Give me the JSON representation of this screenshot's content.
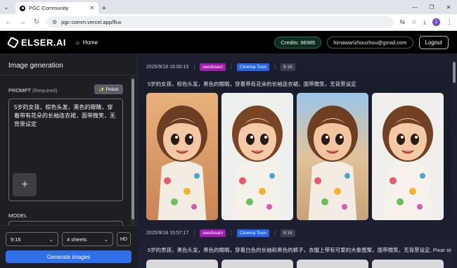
{
  "browser": {
    "tab_title": "PGC Community",
    "url": "pgc-comm.vercel.app/flux",
    "profile_initial": "Z"
  },
  "header": {
    "logo": "ELSER.AI",
    "home": "Home",
    "credits": "Credits: 96985",
    "email": "himawarizhouzhou@gmail.com",
    "logout": "Logout"
  },
  "left": {
    "title": "Image generation",
    "prompt_label": "PROMPT",
    "prompt_required": "(Required)",
    "polish": "Polish",
    "prompt_text": "5岁的女孩，棕色头发，黑色的眼睛，穿着带有花朵的长袖连衣裙，面带微笑，无背景设定",
    "model_label": "MODEL",
    "ratio": "9:16",
    "sheets": "4 sheets",
    "hd": "HD",
    "generate": "Generate images"
  },
  "feed": [
    {
      "datetime": "2025/9/18 16:00:15",
      "model": "seedream",
      "style": "Cinema Toon",
      "ratio": "9:16",
      "prompt": "5岁的女孩，棕色头发，黑色的眼睛，穿着带有花朵的长袖连衣裙，面带微笑，无背景设定"
    },
    {
      "datetime": "2025/9/18 15:57:17",
      "model": "seedream",
      "style": "Cinema Toon",
      "ratio": "9:16",
      "prompt": "5岁的男孩，黑色头发，黑色的眼睛，穿着白色的长袖和黑色的裤子，衣服上带有可爱的大象图案，面带微笑，无背景设定, Pixar style"
    }
  ],
  "colors": {
    "accent_blue": "#2f6fe8",
    "tag_model": "#a21caf",
    "tag_style": "#2563eb",
    "credits_border": "#1d6f45"
  }
}
